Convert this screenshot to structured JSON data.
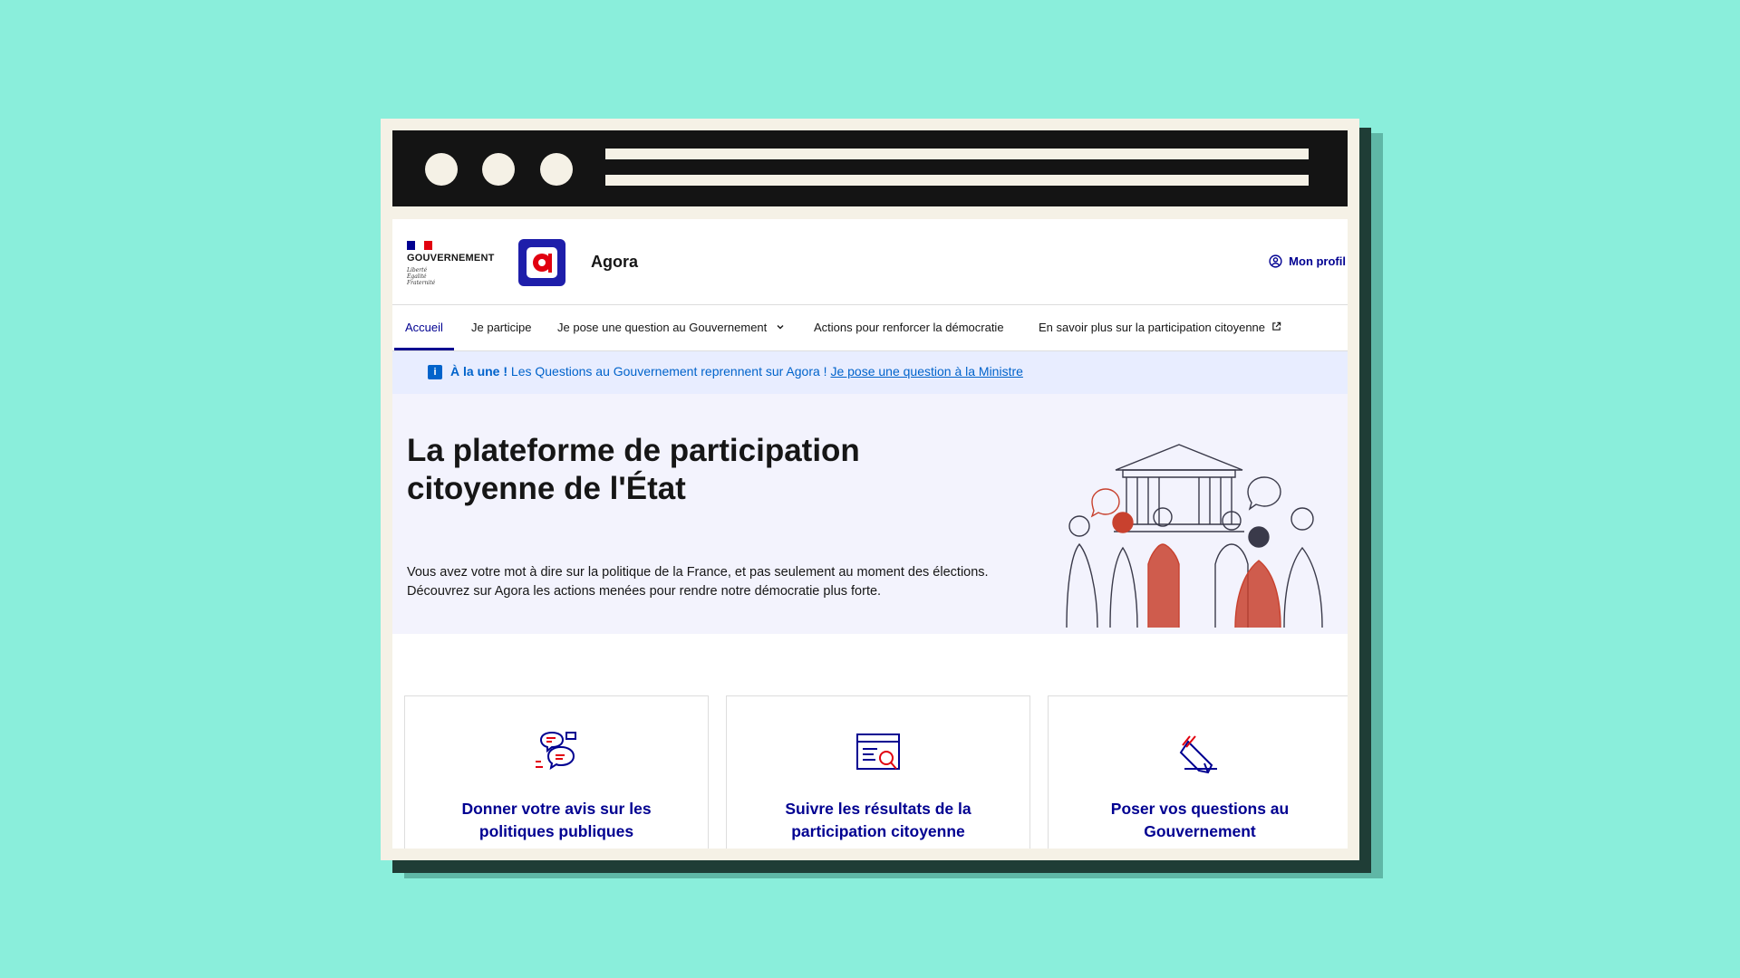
{
  "colors": {
    "background": "#8aeedb",
    "frame": "#f5f1e6",
    "titlebar": "#141414",
    "primary_blue": "#000091",
    "marianne_red": "#e1000f",
    "info_blue": "#0063cb",
    "hero_bg": "#f3f3fd"
  },
  "header": {
    "gov_name": "GOUVERNEMENT",
    "gov_motto": [
      "Liberté",
      "Égalité",
      "Fraternité"
    ],
    "app_logo_icon": "agora-logo",
    "app_name": "Agora",
    "profile_icon": "user-circle-icon",
    "profile_label": "Mon profil"
  },
  "nav": {
    "items": [
      {
        "label": "Accueil",
        "active": true
      },
      {
        "label": "Je participe"
      },
      {
        "label": "Je pose une question au Gouvernement",
        "icon": "chevron-down-icon"
      },
      {
        "label": "Actions pour renforcer la démocratie"
      },
      {
        "label": "En savoir plus sur la participation citoyenne",
        "icon": "external-link-icon"
      }
    ]
  },
  "notice": {
    "icon": "info-icon",
    "title": "À la une !",
    "text": "Les Questions au Gouvernement reprennent sur Agora !",
    "link": "Je pose une question à la Ministre"
  },
  "hero": {
    "title": "La plateforme de participation citoyenne de l'État",
    "desc_line1": "Vous avez votre mot à dire sur la politique de la France, et pas seulement au moment des élections.",
    "desc_line2": "Découvrez sur Agora les actions menées pour rendre notre démocratie plus forte.",
    "illustration": "citizens-illustration"
  },
  "cards": [
    {
      "icon": "speech-bubbles-icon",
      "label": "Donner votre avis sur les politiques publiques"
    },
    {
      "icon": "browser-search-icon",
      "label": "Suivre les résultats de la participation citoyenne"
    },
    {
      "icon": "pen-icon",
      "label": "Poser vos questions au Gouvernement"
    }
  ]
}
